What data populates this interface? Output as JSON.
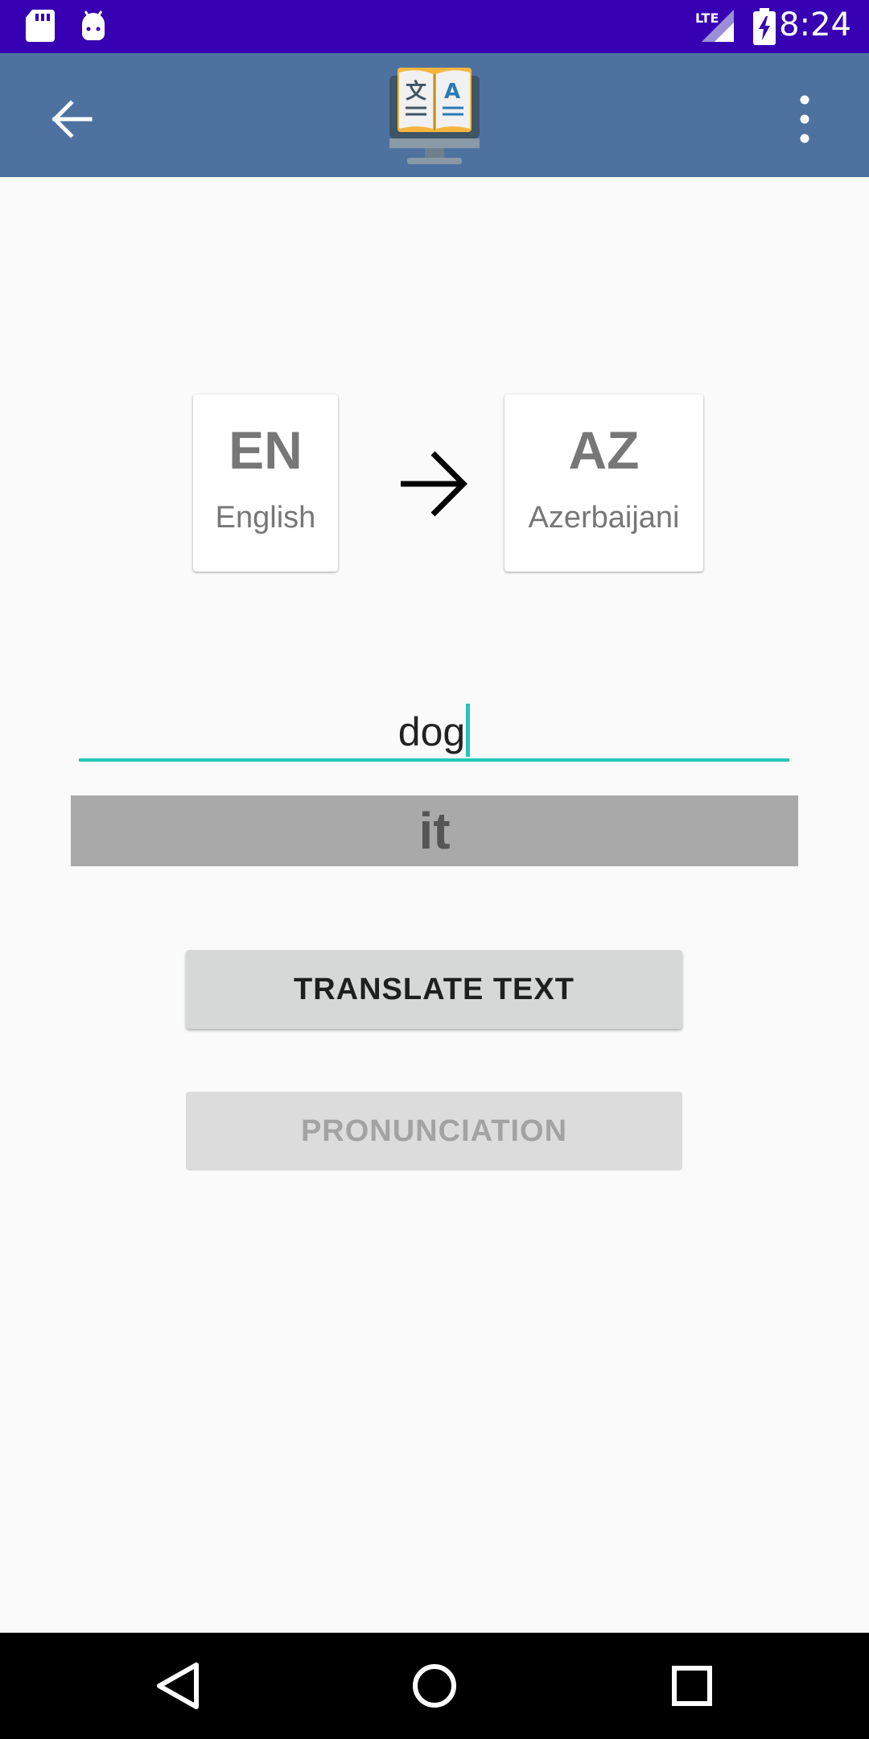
{
  "status_bar": {
    "time": "8:24",
    "network": "LTE",
    "icons": [
      "sd-card-icon",
      "android-debug-icon",
      "lte-signal-icon",
      "battery-charging-icon"
    ]
  },
  "app_bar": {
    "back_icon": "arrow-back-icon",
    "logo_icon": "translator-book-logo",
    "overflow_icon": "more-vert-icon",
    "background": "#4e72a0"
  },
  "languages": {
    "source": {
      "code": "EN",
      "name": "English"
    },
    "target": {
      "code": "AZ",
      "name": "Azerbaijani"
    },
    "direction_icon": "arrow-forward-icon"
  },
  "input": {
    "value": "dog",
    "underline_color": "#26c6b6"
  },
  "result": {
    "text": "it"
  },
  "buttons": {
    "translate_label": "TRANSLATE TEXT",
    "pronunciation_label": "PRONUNCIATION"
  },
  "nav_bar": {
    "icons": [
      "back-triangle-icon",
      "home-circle-icon",
      "recents-square-icon"
    ]
  },
  "colors": {
    "status_bar": "#3700b3",
    "accent": "#26c6b6",
    "result_bg": "#a9a9a9"
  }
}
